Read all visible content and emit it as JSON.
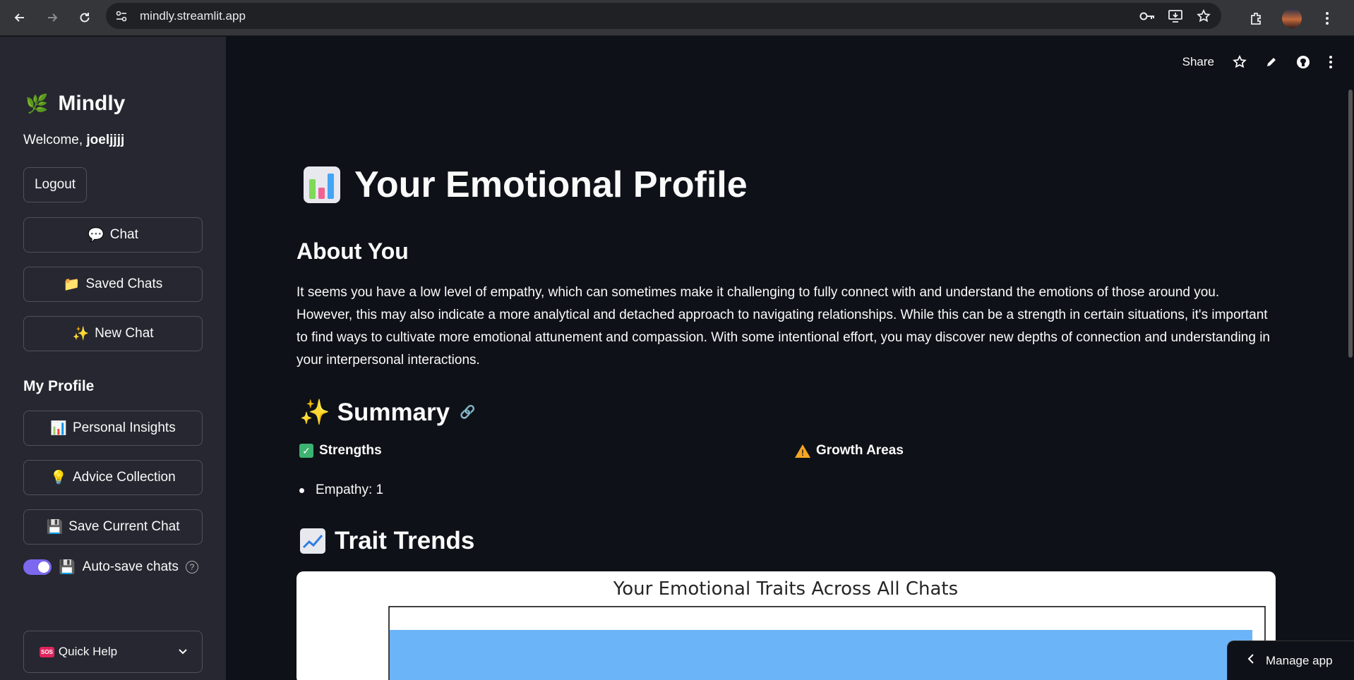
{
  "browser": {
    "url": "mindly.streamlit.app"
  },
  "sidebar": {
    "brand": "Mindly",
    "welcome_prefix": "Welcome, ",
    "username": "joeljjjj",
    "logout_label": "Logout",
    "nav": [
      {
        "icon": "💬",
        "label": "Chat"
      },
      {
        "icon": "📁",
        "label": "Saved Chats"
      },
      {
        "icon": "✨",
        "label": "New Chat"
      }
    ],
    "profile_title": "My Profile",
    "profile_items": [
      {
        "icon": "📊",
        "label": "Personal Insights"
      },
      {
        "icon": "💡",
        "label": "Advice Collection"
      },
      {
        "icon": "💾",
        "label": "Save Current Chat"
      }
    ],
    "autosave": {
      "icon": "💾",
      "label": "Auto-save chats",
      "enabled": true
    },
    "quick_help": {
      "badge": "SOS",
      "label": "Quick Help"
    }
  },
  "toolbar": {
    "share_label": "Share"
  },
  "main": {
    "title": "Your Emotional Profile",
    "about_heading": "About You",
    "about_text": "It seems you have a low level of empathy, which can sometimes make it challenging to fully connect with and understand the emotions of those around you. However, this may also indicate a more analytical and detached approach to navigating relationships. While this can be a strength in certain situations, it's important to find ways to cultivate more emotional attunement and compassion. With some intentional effort, you may discover new depths of connection and understanding in your interpersonal interactions.",
    "summary_heading": "Summary",
    "strengths_label": "Strengths",
    "growth_label": "Growth Areas",
    "strengths_items": [
      "Empathy: 1"
    ],
    "trends_heading": "Trait Trends"
  },
  "manage_app_label": "Manage app",
  "chart_data": {
    "type": "bar",
    "title": "Your Emotional Traits Across All Chats",
    "colors": {
      "bar": "#6cb4f8"
    }
  }
}
